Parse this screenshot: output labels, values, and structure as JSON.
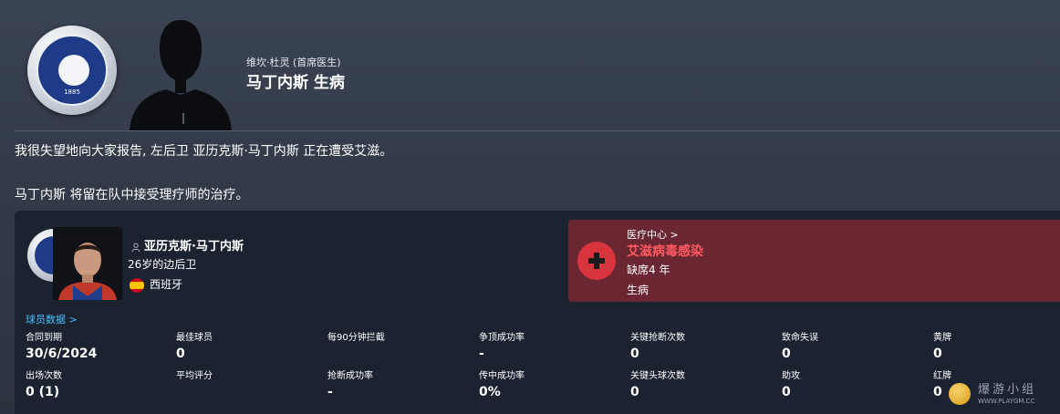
{
  "club": {
    "badge_year": "1885"
  },
  "news": {
    "author": "维坎·杜灵 (首席医生)",
    "headline": "马丁内斯 生病",
    "paragraph1": "我很失望地向大家报告, 左后卫 亚历克斯·马丁内斯 正在遭受艾滋。",
    "paragraph2": "马丁内斯 将留在队中接受理疗师的治疗。"
  },
  "player": {
    "name": "亚历克斯·马丁内斯",
    "age_position": "26岁的边后卫",
    "nationality": "西班牙"
  },
  "medical": {
    "link_label": "医疗中心 >",
    "illness": "艾滋病毒感染",
    "out_for": "缺席4 年",
    "type": "生病",
    "accent_color": "#d8343e",
    "panel_color": "#6a2631"
  },
  "stats": {
    "section_link": "球员数据 >",
    "row1": [
      {
        "label": "合同到期",
        "value": "30/6/2024"
      },
      {
        "label": "最佳球员",
        "value": "0"
      },
      {
        "label": "每90分钟拦截",
        "value": ""
      },
      {
        "label": "争顶成功率",
        "value": "-"
      },
      {
        "label": "关键抢断次数",
        "value": "0"
      },
      {
        "label": "致命失误",
        "value": "0"
      },
      {
        "label": "黄牌",
        "value": "0"
      }
    ],
    "row2": [
      {
        "label": "出场次数",
        "value": "0 (1)"
      },
      {
        "label": "平均评分",
        "value": ""
      },
      {
        "label": "抢断成功率",
        "value": "-"
      },
      {
        "label": "传中成功率",
        "value": "0%"
      },
      {
        "label": "关键头球次数",
        "value": "0"
      },
      {
        "label": "助攻",
        "value": "0"
      },
      {
        "label": "红牌",
        "value": "0"
      }
    ]
  },
  "watermark": {
    "title": "爆游小组",
    "url": "WWW.PLAYGM.CC"
  }
}
